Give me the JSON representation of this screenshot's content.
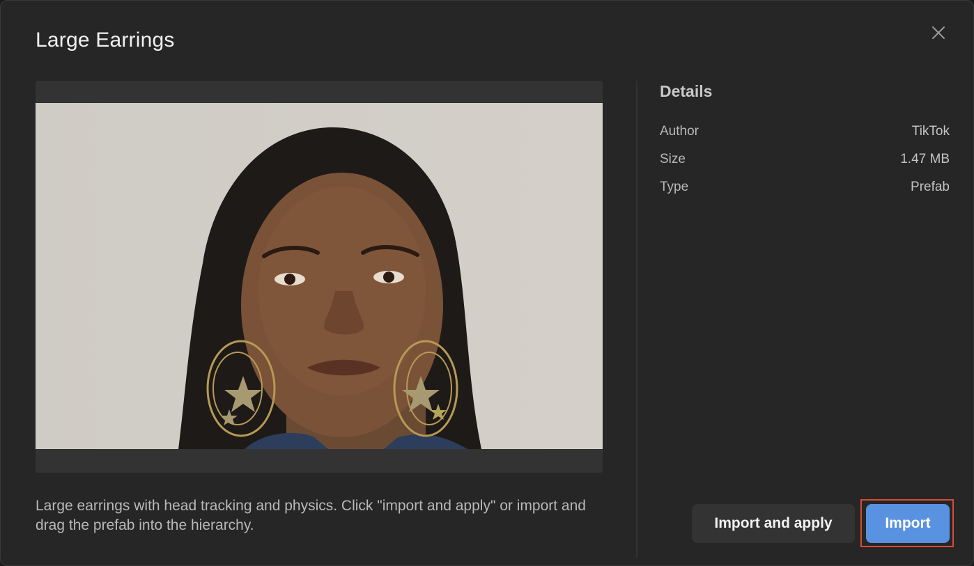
{
  "dialog": {
    "title": "Large Earrings",
    "close_icon": "close-icon"
  },
  "preview": {
    "alt": "Portrait of a woman wearing large gold hoop earrings with star charms"
  },
  "description": "Large earrings with head tracking and physics. Click \"import and apply\" or import and drag the prefab into the hierarchy.",
  "details": {
    "heading": "Details",
    "rows": [
      {
        "label": "Author",
        "value": "TikTok"
      },
      {
        "label": "Size",
        "value": "1.47 MB"
      },
      {
        "label": "Type",
        "value": "Prefab"
      }
    ]
  },
  "actions": {
    "import_and_apply": "Import and apply",
    "import": "Import"
  },
  "colors": {
    "background": "#262626",
    "primary_button": "#5a92e2",
    "secondary_button": "#333333",
    "focus_outline": "#d94a36"
  }
}
